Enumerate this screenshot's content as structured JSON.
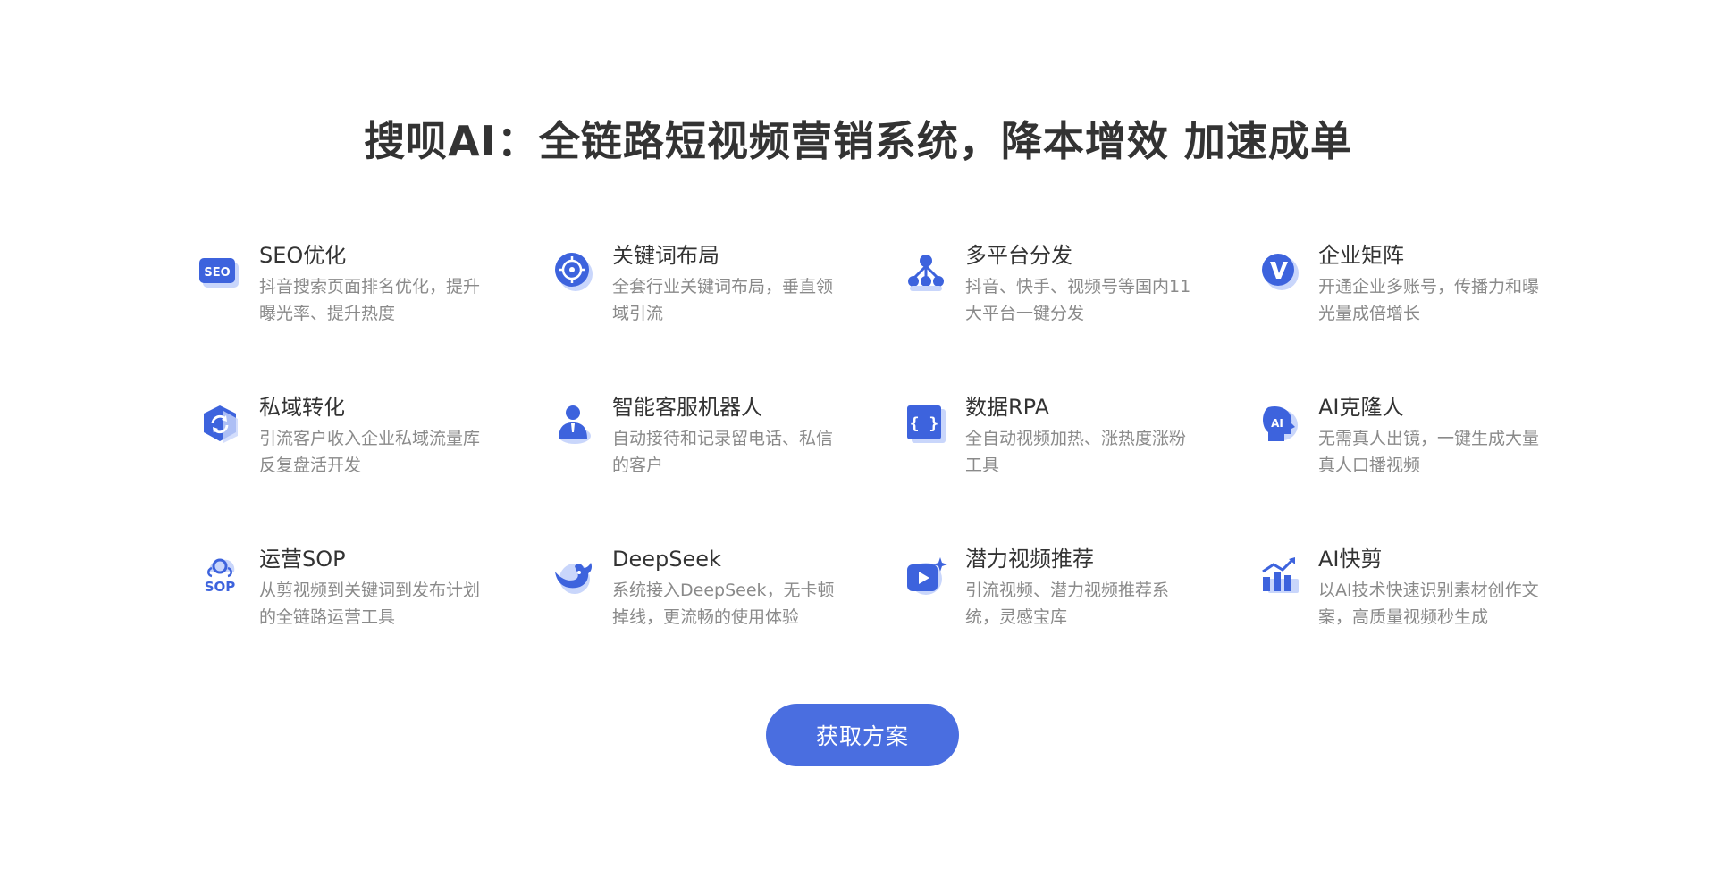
{
  "header": {
    "title": "搜呗AI：全链路短视频营销系统，降本增效 加速成单"
  },
  "features": [
    {
      "icon": "seo-icon",
      "title": "SEO优化",
      "desc": "抖音搜索页面排名优化，提升曝光率、提升热度"
    },
    {
      "icon": "target-icon",
      "title": "关键词布局",
      "desc": "全套行业关键词布局，垂直领域引流"
    },
    {
      "icon": "network-icon",
      "title": "多平台分发",
      "desc": "抖音、快手、视频号等国内11大平台一键分发"
    },
    {
      "icon": "v-badge-icon",
      "title": "企业矩阵",
      "desc": "开通企业多账号，传播力和曝光量成倍增长"
    },
    {
      "icon": "cube-refresh-icon",
      "title": "私域转化",
      "desc": "引流客户收入企业私域流量库反复盘活开发"
    },
    {
      "icon": "customer-service-icon",
      "title": "智能客服机器人",
      "desc": "自动接待和记录留电话、私信的客户"
    },
    {
      "icon": "code-braces-icon",
      "title": "数据RPA",
      "desc": "全自动视频加热、涨热度涨粉工具"
    },
    {
      "icon": "ai-head-icon",
      "title": "AI克隆人",
      "desc": "无需真人出镜，一键生成大量真人口播视频"
    },
    {
      "icon": "sop-icon",
      "title": "运营SOP",
      "desc": "从剪视频到关键词到发布计划的全链路运营工具"
    },
    {
      "icon": "whale-icon",
      "title": "DeepSeek",
      "desc": "系统接入DeepSeek，无卡顿掉线，更流畅的使用体验"
    },
    {
      "icon": "video-play-icon",
      "title": "潜力视频推荐",
      "desc": "引流视频、潜力视频推荐系统，灵感宝库"
    },
    {
      "icon": "bar-chart-icon",
      "title": "AI快剪",
      "desc": "以AI技术快速识别素材创作文案，高质量视频秒生成"
    }
  ],
  "cta": {
    "label": "获取方案"
  },
  "colors": {
    "accent": "#4a6ee0",
    "icon_blue": "#3d63dd",
    "icon_shadow": "#c9d6fb",
    "title": "#333333",
    "desc": "#8a8a8a"
  }
}
